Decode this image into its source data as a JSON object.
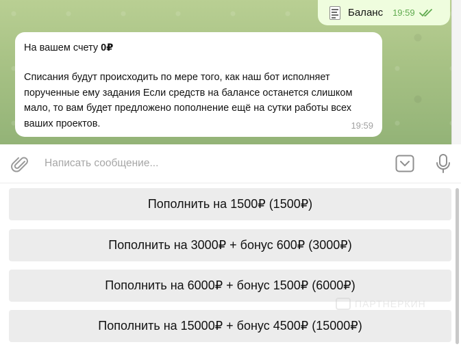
{
  "messages": {
    "outgoing": {
      "icon": "document-icon",
      "text": "Баланс",
      "time": "19:59",
      "status": "read"
    },
    "incoming": {
      "balance_prefix": "На вашем счету ",
      "balance_value": "0₽",
      "body": "Списания будут происходить по мере того, как наш бот исполняет порученные ему задания Если средств на балансе останется слишком мало, то вам будет предложено пополнение ещё на сутки работы всех ваших проектов.",
      "time": "19:59"
    }
  },
  "composer": {
    "placeholder": "Написать сообщение..."
  },
  "keyboard": {
    "buttons": [
      "Пополнить на 1500₽ (1500₽)",
      "Пополнить на 3000₽ + бонус 600₽ (3000₽)",
      "Пополнить на 6000₽ + бонус 1500₽ (6000₽)",
      "Пополнить на 15000₽ + бонус 4500₽ (15000₽)"
    ]
  },
  "watermark": {
    "text": "ПАРТНЕРКИН"
  },
  "colors": {
    "chat_bg": "#a9c386",
    "outgoing_bubble": "#effdde",
    "read_check": "#5faa4e",
    "button_bg": "#ececec"
  }
}
